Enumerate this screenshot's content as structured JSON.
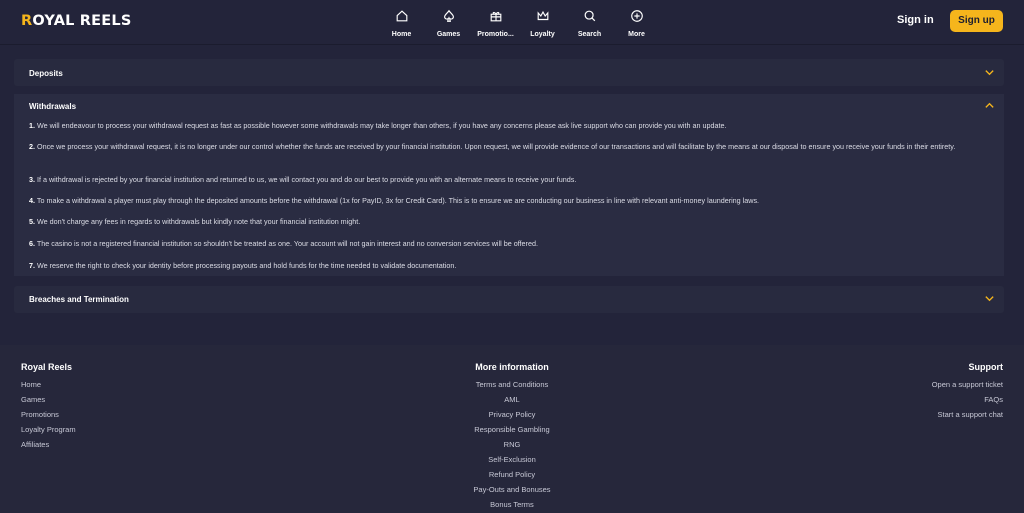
{
  "header": {
    "logo_crown": "R",
    "logo_text": "OYAL REELS",
    "nav": [
      {
        "label": "Home",
        "icon": "home-icon"
      },
      {
        "label": "Games",
        "icon": "spade-icon"
      },
      {
        "label": "Promotio...",
        "icon": "gift-icon"
      },
      {
        "label": "Loyalty",
        "icon": "crown-icon"
      },
      {
        "label": "Search",
        "icon": "search-icon"
      },
      {
        "label": "More",
        "icon": "plus-circle-icon"
      }
    ],
    "signin_label": "Sign in",
    "signup_label": "Sign up"
  },
  "faq": {
    "deposits": {
      "title": "Deposits"
    },
    "withdrawals": {
      "title": "Withdrawals",
      "items": [
        {
          "num": "1.",
          "text": "We will endeavour to process your withdrawal request as fast as possible however some withdrawals may take longer than others, if you have any concerns please ask live support who can provide you with an update."
        },
        {
          "num": "2.",
          "text": "Once we process your withdrawal request, it is no longer under our control whether the funds are received by your financial institution. Upon request, we will provide evidence of our transactions and will facilitate by the means at our disposal to ensure you receive your funds in their entirety."
        },
        {
          "num": "3.",
          "text": "If a withdrawal is rejected by your financial institution and returned to us, we will contact you and do our best to provide you with an alternate means to receive your funds."
        },
        {
          "num": "4.",
          "text": "To make a withdrawal a player must play through the deposited amounts before the withdrawal (1x for PayID, 3x for Credit Card). This is to ensure we are conducting our business in line with relevant anti-money laundering laws."
        },
        {
          "num": "5.",
          "text": "We don't charge any fees in regards to withdrawals but kindly note that your financial institution might."
        },
        {
          "num": "6.",
          "text": "The casino is not a registered financial institution so shouldn't be treated as one. Your account will not gain interest and no conversion services will be offered."
        },
        {
          "num": "7.",
          "text": "We reserve the right to check your identity before processing payouts and hold funds for the time needed to validate documentation."
        }
      ]
    },
    "breaches": {
      "title": "Breaches and Termination"
    }
  },
  "footer": {
    "col1": {
      "title": "Royal Reels",
      "links": [
        "Home",
        "Games",
        "Promotions",
        "Loyalty Program",
        "Affiliates"
      ]
    },
    "col2": {
      "title": "More information",
      "links": [
        "Terms and Conditions",
        "AML",
        "Privacy Policy",
        "Responsible Gambling",
        "RNG",
        "Self-Exclusion",
        "Refund Policy",
        "Pay-Outs and Bonuses",
        "Bonus Terms"
      ]
    },
    "col3": {
      "title": "Support",
      "links": [
        "Open a support ticket",
        "FAQs",
        "Start a support chat"
      ]
    }
  },
  "colors": {
    "accent": "#f5b51c",
    "background": "#23243a",
    "panel": "#2a2c42"
  }
}
